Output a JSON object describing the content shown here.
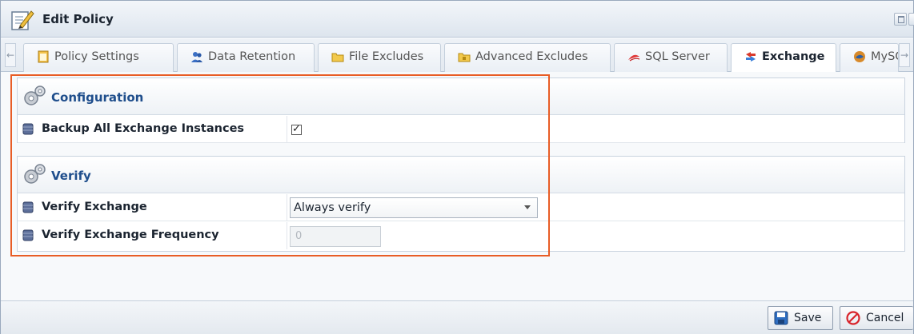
{
  "window": {
    "title": "Edit Policy"
  },
  "tabs": [
    {
      "label": "Policy Settings",
      "icon": "policy-icon",
      "active": false
    },
    {
      "label": "Data Retention",
      "icon": "users-icon",
      "active": false
    },
    {
      "label": "File Excludes",
      "icon": "folder-icon",
      "active": false
    },
    {
      "label": "Advanced Excludes",
      "icon": "folder-icon",
      "active": false
    },
    {
      "label": "SQL Server",
      "icon": "sql-server-icon",
      "active": false
    },
    {
      "label": "Exchange",
      "icon": "exchange-icon",
      "active": true
    },
    {
      "label": "MySQ",
      "icon": "mysql-icon",
      "active": false
    }
  ],
  "configuration": {
    "title": "Configuration",
    "backup_all_label": "Backup All Exchange Instances",
    "backup_all_checked": true
  },
  "verify": {
    "title": "Verify",
    "verify_exchange_label": "Verify Exchange",
    "verify_exchange_value": "Always verify",
    "frequency_label": "Verify Exchange Frequency",
    "frequency_value": "0"
  },
  "footer": {
    "save_label": "Save",
    "cancel_label": "Cancel"
  },
  "colors": {
    "highlight": "#e85d26",
    "section_title": "#1f4e8c"
  }
}
